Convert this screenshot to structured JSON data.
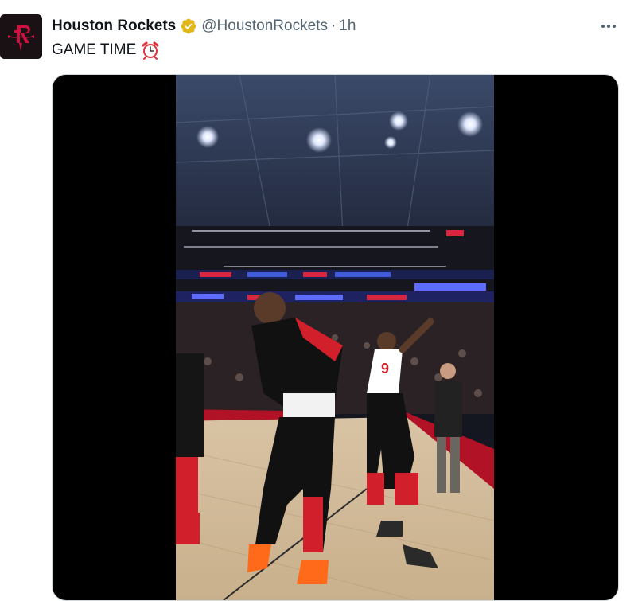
{
  "tweet": {
    "author": {
      "name": "Houston Rockets",
      "handle": "@HoustonRockets",
      "verified": true,
      "avatar_icon": "houston-rockets-logo-icon"
    },
    "separator": "·",
    "time": "1h",
    "text": "GAME TIME",
    "emoji": "alarm-clock-icon",
    "more_icon": "more-options-icon",
    "media": {
      "type": "video",
      "description_icon": "basketball-video-icon"
    }
  },
  "colors": {
    "brand_red": "#ce1141",
    "verified_gold": "#e2b719",
    "text_primary": "#0f1419",
    "text_secondary": "#536471"
  }
}
